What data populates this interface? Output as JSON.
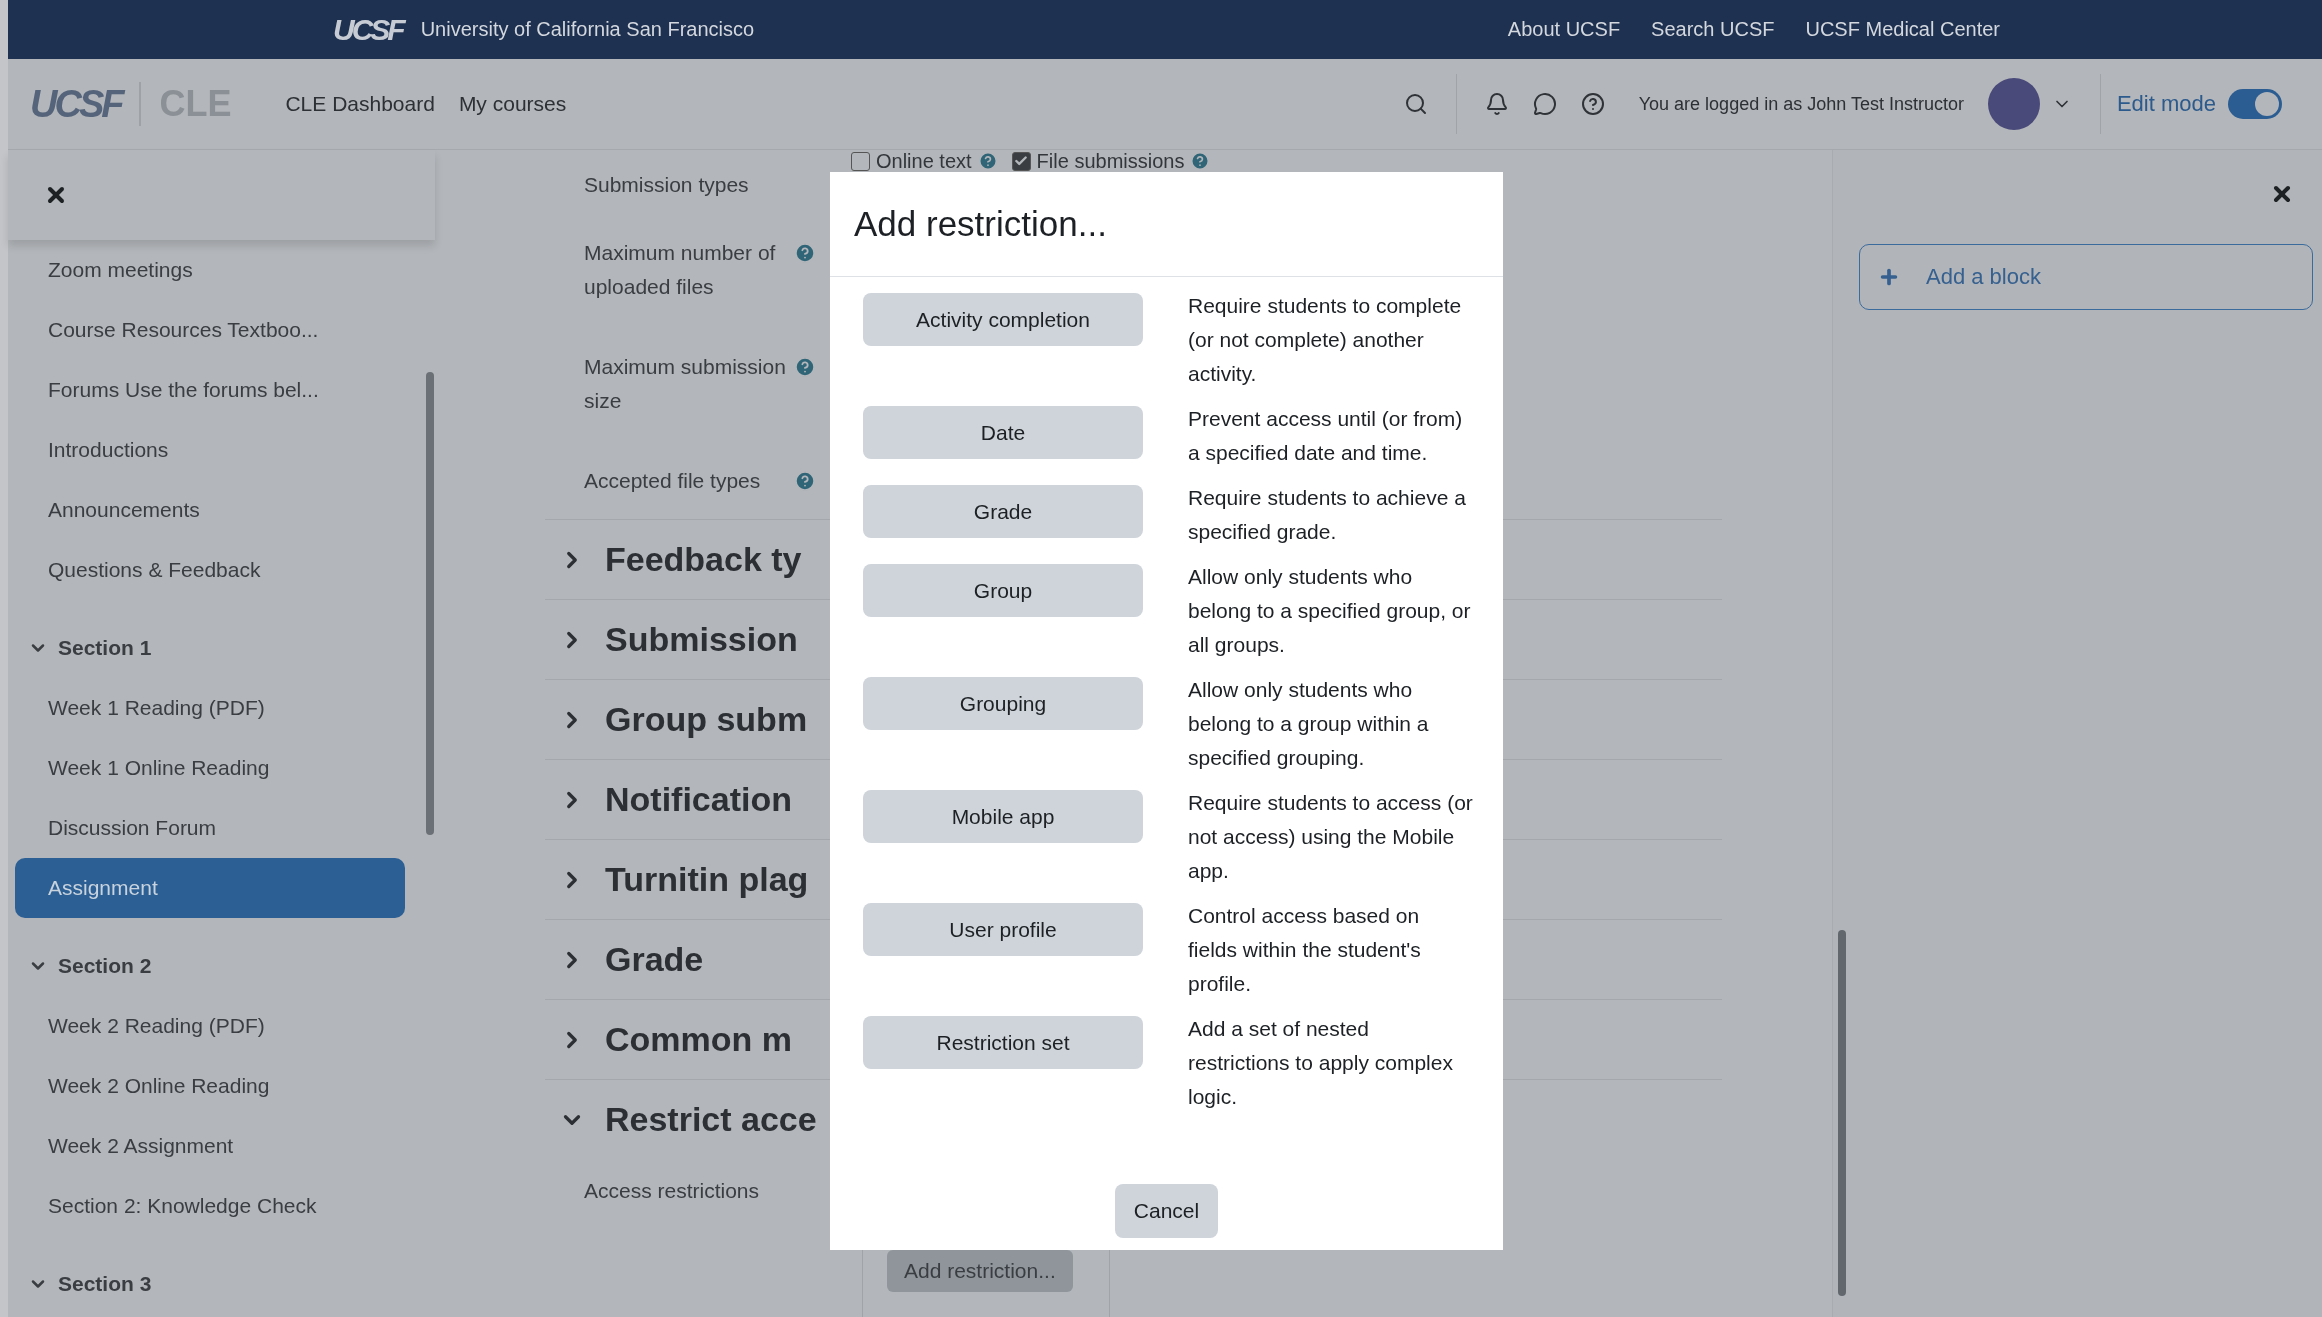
{
  "top_bar": {
    "logo": "UCSF",
    "title": "University of California San Francisco",
    "links": [
      "About UCSF",
      "Search UCSF",
      "UCSF Medical Center"
    ]
  },
  "nav": {
    "logo": "UCSF",
    "product": "CLE",
    "links": [
      "CLE Dashboard",
      "My courses"
    ],
    "login_text": "You are logged in as John Test Instructor",
    "edit_mode": {
      "label": "Edit mode",
      "on": true
    }
  },
  "course_index": {
    "items": [
      {
        "label": "Zoom meetings",
        "selected": false
      },
      {
        "label": "Course Resources  Textboo...",
        "selected": false
      },
      {
        "label": "Forums Use the forums bel...",
        "selected": false
      },
      {
        "label": "Introductions",
        "selected": false
      },
      {
        "label": "Announcements",
        "selected": false
      },
      {
        "label": "Questions & Feedback",
        "selected": false
      }
    ],
    "sections": [
      {
        "title": "Section 1",
        "expanded": true,
        "children": [
          {
            "label": "Week 1 Reading (PDF)",
            "selected": false
          },
          {
            "label": "Week 1 Online Reading",
            "selected": false
          },
          {
            "label": "Discussion Forum",
            "selected": false
          },
          {
            "label": "Assignment",
            "selected": true
          }
        ]
      },
      {
        "title": "Section 2",
        "expanded": true,
        "children": [
          {
            "label": "Week 2 Reading (PDF)",
            "selected": false
          },
          {
            "label": "Week 2 Online Reading",
            "selected": false
          },
          {
            "label": "Week 2 Assignment",
            "selected": false
          },
          {
            "label": "Section 2: Knowledge Check",
            "selected": false
          }
        ]
      },
      {
        "title": "Section 3",
        "expanded": true
      }
    ]
  },
  "form": {
    "submission_options": [
      {
        "label": "Online text",
        "checked": false
      },
      {
        "label": "File submissions",
        "checked": true
      }
    ],
    "fields": [
      {
        "label": "Submission types",
        "help": false
      },
      {
        "label": "Maximum number of uploaded files",
        "help": true
      },
      {
        "label": "Maximum submission size",
        "help": true
      },
      {
        "label": "Accepted file types",
        "help": true
      }
    ],
    "sections": [
      {
        "title": "Feedback ty",
        "expanded": false
      },
      {
        "title": "Submission",
        "expanded": false
      },
      {
        "title": "Group subm",
        "expanded": false
      },
      {
        "title": "Notification",
        "expanded": false
      },
      {
        "title": "Turnitin plag",
        "expanded": false
      },
      {
        "title": "Grade",
        "expanded": false
      },
      {
        "title": "Common m",
        "expanded": false
      },
      {
        "title": "Restrict acce",
        "expanded": true
      }
    ],
    "access_label": "Access restrictions",
    "add_button": "Add restriction..."
  },
  "blocks": {
    "add_block": "Add a block"
  },
  "modal": {
    "title": "Add restriction...",
    "options": [
      {
        "label": "Activity completion",
        "description": "Require students to complete (or not complete) another activity."
      },
      {
        "label": "Date",
        "description": "Prevent access until (or from) a specified date and time."
      },
      {
        "label": "Grade",
        "description": "Require students to achieve a specified grade."
      },
      {
        "label": "Group",
        "description": "Allow only students who belong to a specified group, or all groups."
      },
      {
        "label": "Grouping",
        "description": "Allow only students who belong to a group within a specified grouping."
      },
      {
        "label": "Mobile app",
        "description": "Require students to access (or not access) using the Mobile app."
      },
      {
        "label": "User profile",
        "description": "Control access based on fields within the student's profile."
      },
      {
        "label": "Restriction set",
        "description": "Add a set of nested restrictions to apply complex logic."
      }
    ],
    "cancel": "Cancel"
  }
}
